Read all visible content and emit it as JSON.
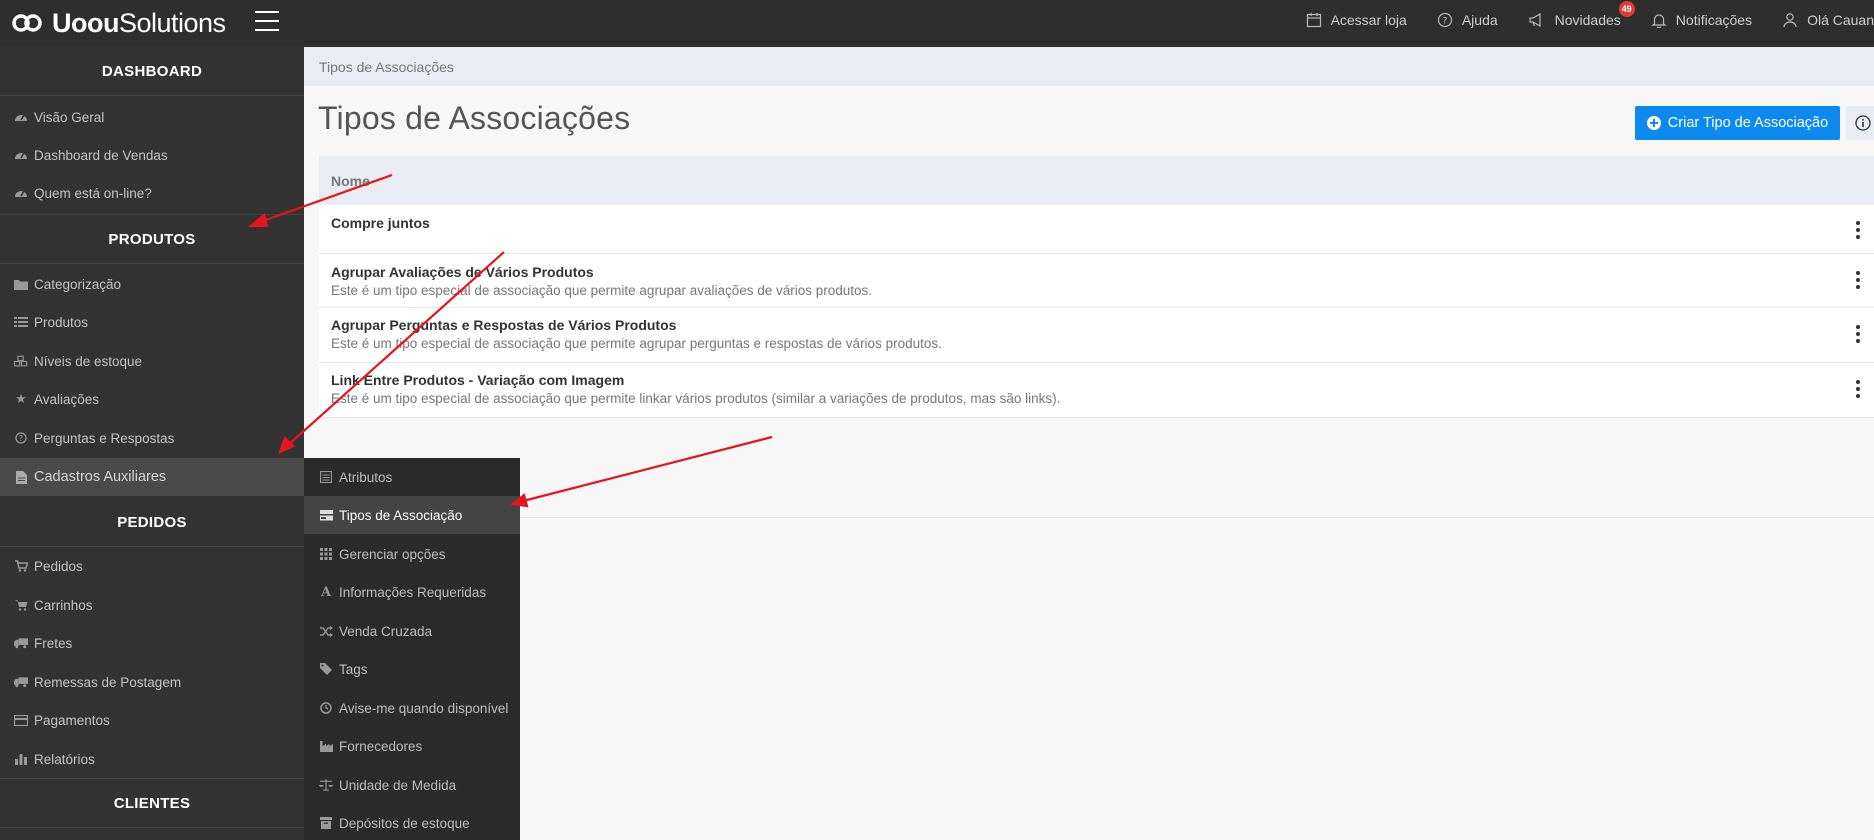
{
  "app": {
    "logo_bold": "Uoou",
    "logo_light": "Solutions"
  },
  "topbar": {
    "actions": [
      {
        "label": "Acessar loja",
        "icon": "calendar-icon"
      },
      {
        "label": "Ajuda",
        "icon": "help-circle-icon"
      },
      {
        "label": "Novidades",
        "icon": "megaphone-icon",
        "badge": "49"
      },
      {
        "label": "Notificações",
        "icon": "bell-icon"
      },
      {
        "label": "Olá Cauan",
        "icon": "user-icon"
      }
    ]
  },
  "sidebar": {
    "sections": [
      {
        "title": "DASHBOARD",
        "items": [
          {
            "label": "Visão Geral",
            "icon": "dashboard-gauge-icon"
          },
          {
            "label": "Dashboard de Vendas",
            "icon": "dashboard-gauge-icon"
          },
          {
            "label": "Quem está on-line?",
            "icon": "dashboard-gauge-icon"
          }
        ]
      },
      {
        "title": "PRODUTOS",
        "items": [
          {
            "label": "Categorização",
            "icon": "folder-icon"
          },
          {
            "label": "Produtos",
            "icon": "list-icon"
          },
          {
            "label": "Níveis de estoque",
            "icon": "cubes-icon"
          },
          {
            "label": "Avaliações",
            "icon": "star-icon"
          },
          {
            "label": "Perguntas e Respostas",
            "icon": "question-circle-icon"
          },
          {
            "label": "Cadastros Auxiliares",
            "icon": "file-icon",
            "active": true
          }
        ]
      },
      {
        "title": "PEDIDOS",
        "items": [
          {
            "label": "Pedidos",
            "icon": "basket-icon"
          },
          {
            "label": "Carrinhos",
            "icon": "cart-icon"
          },
          {
            "label": "Fretes",
            "icon": "truck-icon"
          },
          {
            "label": "Remessas de Postagem",
            "icon": "truck-icon"
          },
          {
            "label": "Pagamentos",
            "icon": "credit-card-icon"
          },
          {
            "label": "Relatórios",
            "icon": "bar-chart-icon"
          }
        ]
      },
      {
        "title": "CLIENTES",
        "items": []
      }
    ]
  },
  "flyout": {
    "items": [
      {
        "label": "Atributos",
        "icon": "list-alt-icon"
      },
      {
        "label": "Tipos de Associação",
        "icon": "tasks-icon",
        "active": true
      },
      {
        "label": "Gerenciar opções",
        "icon": "grid-icon"
      },
      {
        "label": "Informações Requeridas",
        "icon": "font-icon"
      },
      {
        "label": "Venda Cruzada",
        "icon": "shuffle-icon"
      },
      {
        "label": "Tags",
        "icon": "tags-icon"
      },
      {
        "label": "Avise-me quando disponível",
        "icon": "clock-icon"
      },
      {
        "label": "Fornecedores",
        "icon": "industry-icon"
      },
      {
        "label": "Unidade de Medida",
        "icon": "balance-scale-icon"
      },
      {
        "label": "Depósitos de estoque",
        "icon": "archive-icon"
      }
    ]
  },
  "main": {
    "breadcrumb": "Tipos de Associações",
    "title": "Tipos de Associações",
    "create_button": "Criar Tipo de Associação",
    "table": {
      "column": "Nome",
      "rows": [
        {
          "name": "Compre juntos",
          "desc": ""
        },
        {
          "name": "Agrupar Avaliações de Vários Produtos",
          "desc": "Este é um tipo especial de associação que permite agrupar avaliações de vários produtos."
        },
        {
          "name": "Agrupar Perguntas e Respostas de Vários Produtos",
          "desc": "Este é um tipo especial de associação que permite agrupar perguntas e respostas de vários produtos."
        },
        {
          "name": "Link Entre Produtos - Variação com Imagem",
          "desc": "Este é um tipo especial de associação que permite linkar vários produtos (similar a variações de produtos, mas são links)."
        }
      ]
    }
  },
  "colors": {
    "topbar": "#2e2e2e",
    "sidebar": "#333333",
    "flyout": "#2b2b2b",
    "primary": "#0d8af0",
    "badge": "#e53935",
    "annotation_arrow": "#e8141c"
  }
}
